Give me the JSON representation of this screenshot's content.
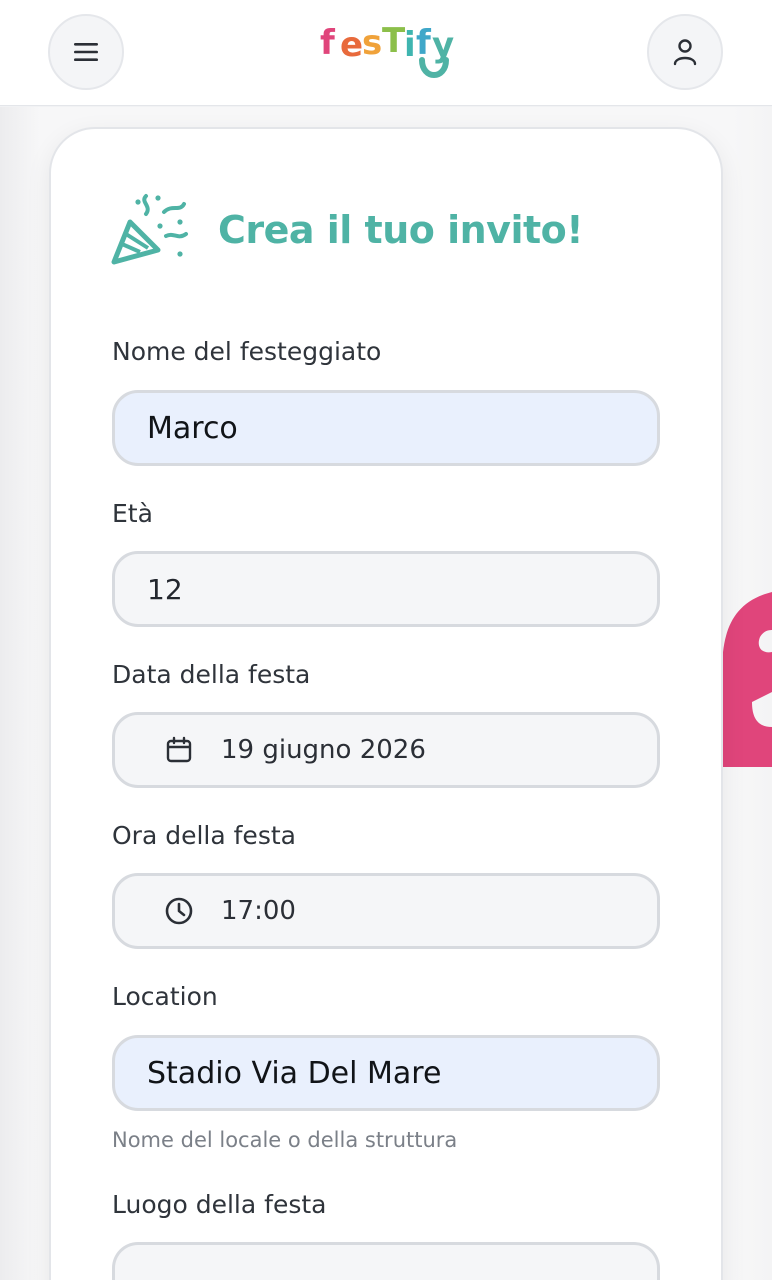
{
  "header": {
    "logo_text": "festify",
    "menu_icon": "hamburger-menu-icon",
    "user_icon": "user-icon"
  },
  "form": {
    "title": "Crea il tuo invito!",
    "title_icon": "party-popper-icon",
    "fields": {
      "name": {
        "label": "Nome del festeggiato",
        "value": "Marco"
      },
      "age": {
        "label": "Età",
        "value": "12"
      },
      "date": {
        "label": "Data della festa",
        "value": "19 giugno 2026",
        "icon": "calendar-icon"
      },
      "time": {
        "label": "Ora della festa",
        "value": "17:00",
        "icon": "clock-icon"
      },
      "location": {
        "label": "Location",
        "value": "Stadio Via Del Mare",
        "hint": "Nome del locale o della struttura"
      },
      "place": {
        "label": "Luogo della festa",
        "value": ""
      }
    }
  },
  "colors": {
    "accent": "#4fb3a5",
    "autofill_bg": "#e9f0fd",
    "decor_pink": "#e0457b"
  }
}
